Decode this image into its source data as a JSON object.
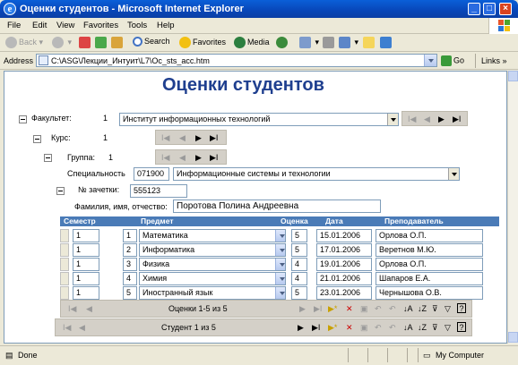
{
  "window": {
    "title": "Оценки студентов - Microsoft Internet Explorer",
    "min_label": "_",
    "max_label": "□",
    "close_label": "×"
  },
  "menu": [
    "File",
    "Edit",
    "View",
    "Favorites",
    "Tools",
    "Help"
  ],
  "toolbar": {
    "back": "Back",
    "search": "Search",
    "favorites": "Favorites",
    "media": "Media"
  },
  "address": {
    "label": "Address",
    "url": "C:\\ASG\\Лекции_Интуит\\L7\\Oc_sts_acc.htm",
    "go": "Go",
    "links": "Links"
  },
  "page": {
    "title": "Оценки студентов",
    "faculty": {
      "label": "Факультет:",
      "number": "1",
      "name": "Институт информационных технологий"
    },
    "course": {
      "label": "Курс:",
      "number": "1"
    },
    "group": {
      "label": "Группа:",
      "number": "1"
    },
    "specialty": {
      "label": "Специальность",
      "code": "071900",
      "name": "Информационные системы и технологии"
    },
    "record_book": {
      "label": "№ зачетки:",
      "value": "555123"
    },
    "fio": {
      "label": "Фамилия, имя, отчество:",
      "value": "Поротова Полина Андреевна"
    },
    "grid": {
      "columns": [
        "Семестр",
        "Предмет",
        "Оценка",
        "Дата",
        "Преподаватель"
      ],
      "rows": [
        {
          "semester": "1",
          "subject_no": "1",
          "subject": "Математика",
          "grade": "5",
          "date": "15.01.2006",
          "teacher": "Орлова О.П."
        },
        {
          "semester": "1",
          "subject_no": "2",
          "subject": "Информатика",
          "grade": "5",
          "date": "17.01.2006",
          "teacher": "Веретнов М.Ю."
        },
        {
          "semester": "1",
          "subject_no": "3",
          "subject": "Физика",
          "grade": "4",
          "date": "19.01.2006",
          "teacher": "Орлова О.П."
        },
        {
          "semester": "1",
          "subject_no": "4",
          "subject": "Химия",
          "grade": "4",
          "date": "21.01.2006",
          "teacher": "Шапаров Е.А."
        },
        {
          "semester": "1",
          "subject_no": "5",
          "subject": "Иностранный язык",
          "grade": "5",
          "date": "23.01.2006",
          "teacher": "Чернышова О.В."
        }
      ]
    },
    "grades_nav": {
      "label": "Оценки 1-5 из 5"
    },
    "student_nav": {
      "label": "Студент 1 из 5"
    }
  },
  "status": {
    "left": "Done",
    "zone": "My Computer"
  }
}
